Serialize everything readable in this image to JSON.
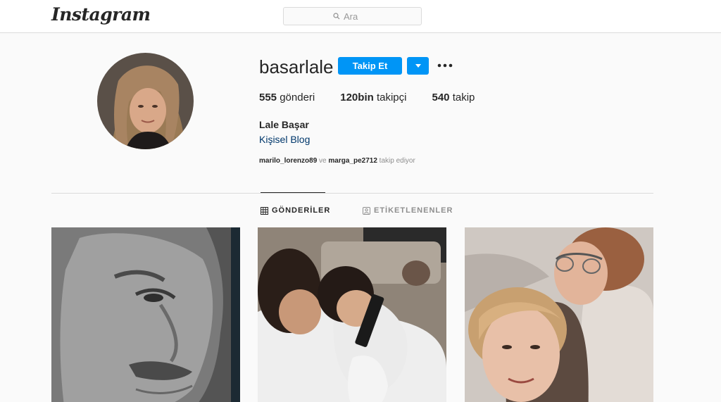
{
  "header": {
    "logo_text": "Instagram",
    "search_placeholder": "Ara"
  },
  "profile": {
    "username": "basarlale",
    "follow_label": "Takip Et",
    "stats": {
      "posts_count": "555",
      "posts_label": "gönderi",
      "followers_count": "120bin",
      "followers_label": "takipçi",
      "following_count": "540",
      "following_label": "takip"
    },
    "full_name": "Lale Başar",
    "bio_link": "Kişisel Blog",
    "followed_by": {
      "user1": "marilo_lorenzo89",
      "conjunction": "ve",
      "user2": "marga_pe2712",
      "suffix": "takip ediyor"
    }
  },
  "tabs": [
    {
      "label": "GÖNDERİLER",
      "icon": "grid-icon",
      "active": true
    },
    {
      "label": "ETİKETLENENLER",
      "icon": "tagged-user-icon",
      "active": false
    }
  ],
  "colors": {
    "accent": "#0095f6",
    "text": "#262626",
    "muted": "#8e8e8e",
    "link": "#00376b",
    "background": "#fafafa",
    "border": "#dbdbdb"
  },
  "icons": [
    "search-icon",
    "chevron-down-icon",
    "more-options-icon",
    "grid-icon",
    "tagged-user-icon"
  ]
}
